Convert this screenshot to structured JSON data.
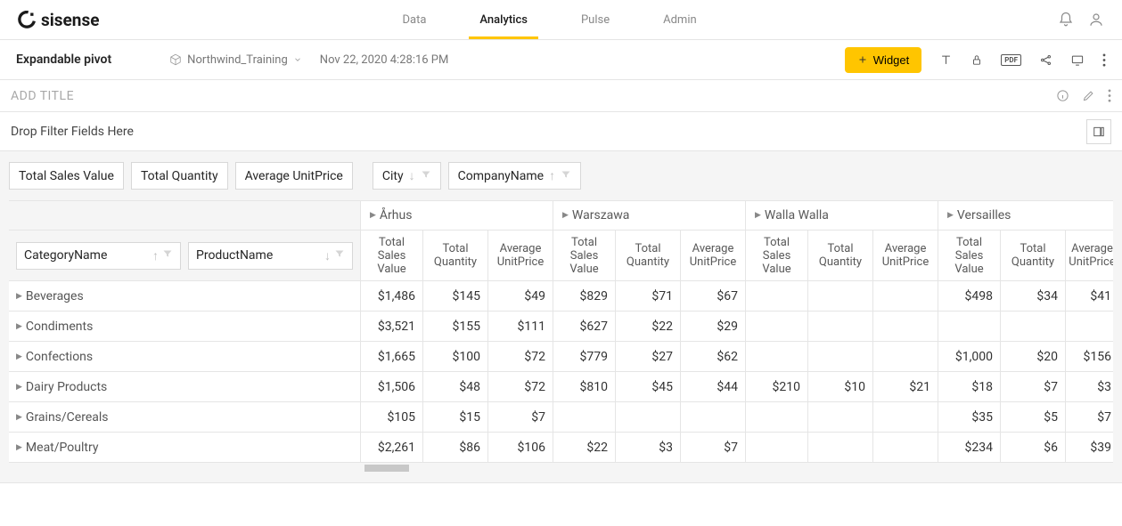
{
  "brand": "sisense",
  "nav": {
    "tabs": [
      "Data",
      "Analytics",
      "Pulse",
      "Admin"
    ],
    "active": 1
  },
  "dashboard": {
    "name": "Expandable pivot",
    "cube": "Northwind_Training",
    "timestamp": "Nov 22, 2020 4:28:16 PM",
    "widget_btn": "Widget",
    "title_placeholder": "ADD TITLE",
    "filter_drop": "Drop Filter Fields Here"
  },
  "pivot": {
    "measures": [
      "Total Sales Value",
      "Total Quantity",
      "Average UnitPrice"
    ],
    "col_dims": [
      {
        "name": "City",
        "sort": "desc"
      },
      {
        "name": "CompanyName",
        "sort": "asc"
      }
    ],
    "row_dims": [
      {
        "name": "CategoryName",
        "sort": "asc"
      },
      {
        "name": "ProductName",
        "sort": "desc"
      }
    ],
    "sub_headers": [
      "Total Sales Value",
      "Total Quantity",
      "Average UnitPrice"
    ],
    "cities": [
      "Århus",
      "Warszawa",
      "Walla Walla",
      "Versailles"
    ],
    "rows": [
      {
        "label": "Beverages",
        "cells": [
          [
            "$1,486",
            "$145",
            "$49"
          ],
          [
            "$829",
            "$71",
            "$67"
          ],
          [
            "",
            "",
            ""
          ],
          [
            "$498",
            "$34",
            "$41"
          ]
        ]
      },
      {
        "label": "Condiments",
        "cells": [
          [
            "$3,521",
            "$155",
            "$111"
          ],
          [
            "$627",
            "$22",
            "$29"
          ],
          [
            "",
            "",
            ""
          ],
          [
            "",
            "",
            ""
          ]
        ]
      },
      {
        "label": "Confections",
        "cells": [
          [
            "$1,665",
            "$100",
            "$72"
          ],
          [
            "$779",
            "$27",
            "$62"
          ],
          [
            "",
            "",
            ""
          ],
          [
            "$1,000",
            "$20",
            "$156"
          ]
        ]
      },
      {
        "label": "Dairy Products",
        "cells": [
          [
            "$1,506",
            "$48",
            "$72"
          ],
          [
            "$810",
            "$45",
            "$44"
          ],
          [
            "$210",
            "$10",
            "$21"
          ],
          [
            "$18",
            "$7",
            "$3"
          ]
        ]
      },
      {
        "label": "Grains/Cereals",
        "cells": [
          [
            "$105",
            "$15",
            "$7"
          ],
          [
            "",
            "",
            ""
          ],
          [
            "",
            "",
            ""
          ],
          [
            "$35",
            "$5",
            "$7"
          ]
        ]
      },
      {
        "label": "Meat/Poultry",
        "cells": [
          [
            "$2,261",
            "$86",
            "$106"
          ],
          [
            "$22",
            "$3",
            "$7"
          ],
          [
            "",
            "",
            ""
          ],
          [
            "$234",
            "$6",
            "$39"
          ]
        ]
      }
    ]
  }
}
